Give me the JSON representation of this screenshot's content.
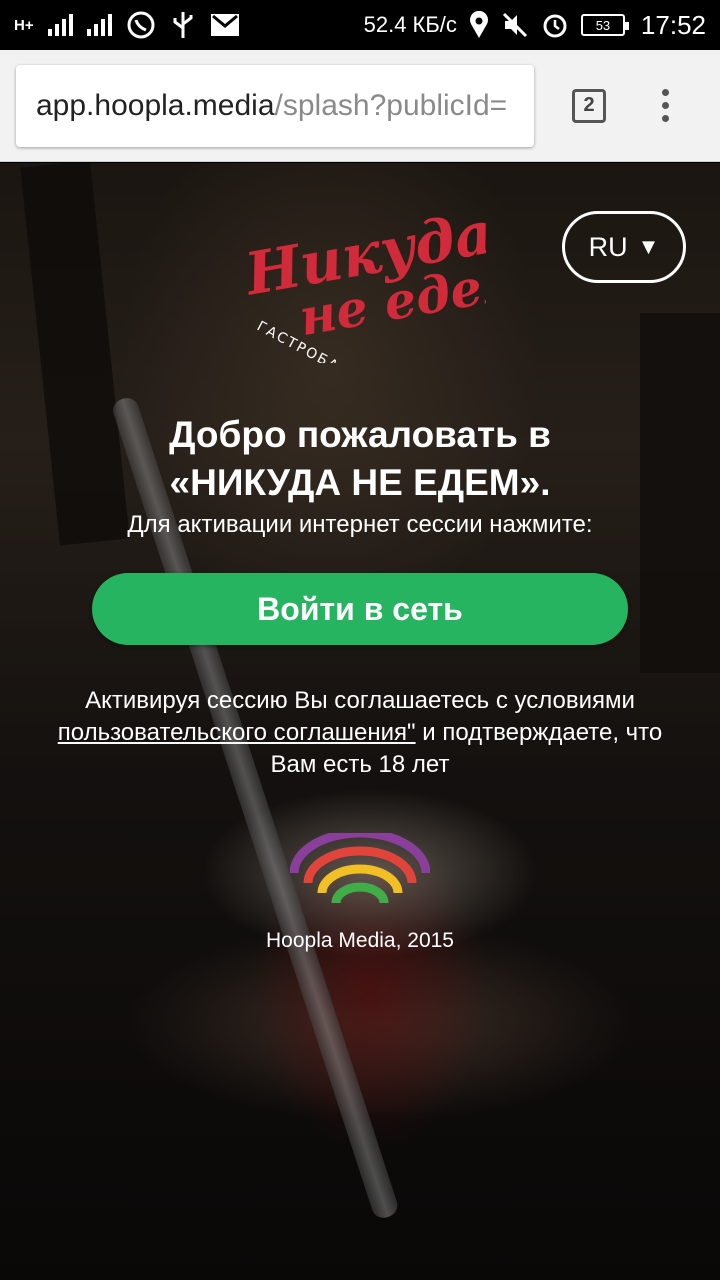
{
  "status_bar": {
    "network": "H+",
    "sim1": "1",
    "sim2": "2",
    "speed": "52.4 КБ/с",
    "battery": "53",
    "time": "17:52"
  },
  "browser": {
    "url_host": "app.hoopla.media",
    "url_path": "/splash?publicId=",
    "tab_count": "2"
  },
  "page": {
    "logo": {
      "line1": "Никуда",
      "line2": "не едем",
      "sub": "ГАСТРОБАР",
      "color": "#d12a3a"
    },
    "language": {
      "value": "RU",
      "arrow": "▼"
    },
    "welcome_line1": "Добро пожаловать в",
    "welcome_line2": "«НИКУДА НЕ ЕДЕМ».",
    "instruction": "Для активации интернет сессии нажмите:",
    "login_button": "Войти в сеть",
    "login_color": "#27b460",
    "terms_before": "Активируя сессию Вы соглашаетесь с условиями ",
    "terms_link": "пользовательского соглашения\"",
    "terms_after": " и подтверждаете, что Вам есть 18 лет",
    "copyright": "Hoopla Media, 2015"
  }
}
